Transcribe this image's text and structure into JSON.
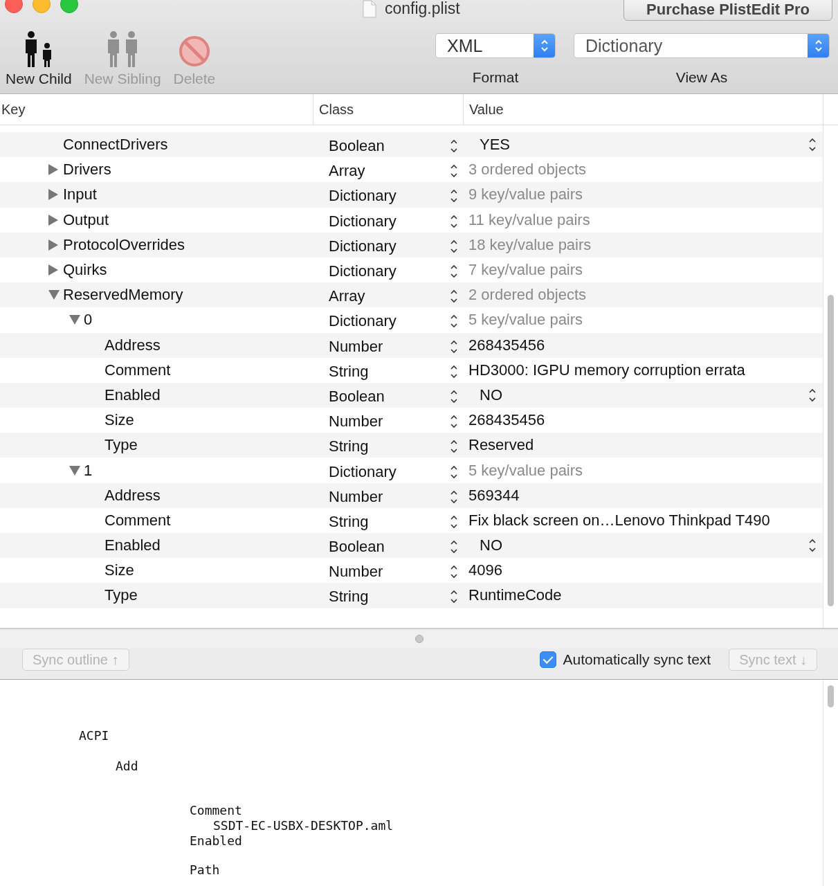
{
  "window": {
    "title": "config.plist",
    "purchase_button": "Purchase PlistEdit Pro"
  },
  "toolbar": {
    "items": [
      {
        "kind": "child",
        "label": "New Child",
        "disabled": false
      },
      {
        "kind": "sibling",
        "label": "New Sibling",
        "disabled": true
      },
      {
        "kind": "delete",
        "label": "Delete",
        "disabled": true
      }
    ],
    "format": {
      "label": "Format",
      "value": "XML"
    },
    "view_as": {
      "label": "View As",
      "value": "Dictionary"
    }
  },
  "table": {
    "columns": [
      "Key",
      "Class",
      "Value"
    ],
    "rows": [
      {
        "key": "ConnectDrivers",
        "class": "Boolean",
        "value": "YES",
        "kind": "bool"
      },
      {
        "key": "Drivers",
        "class": "Array",
        "value": "3 ordered objects",
        "kind": "count",
        "expanded": false
      },
      {
        "key": "Input",
        "class": "Dictionary",
        "value": "9 key/value pairs",
        "kind": "count",
        "expanded": false
      },
      {
        "key": "Output",
        "class": "Dictionary",
        "value": "11 key/value pairs",
        "kind": "count",
        "expanded": false
      },
      {
        "key": "ProtocolOverrides",
        "class": "Dictionary",
        "value": "18 key/value pairs",
        "kind": "count",
        "expanded": false
      },
      {
        "key": "Quirks",
        "class": "Dictionary",
        "value": "7 key/value pairs",
        "kind": "count",
        "expanded": false
      },
      {
        "key": "ReservedMemory",
        "class": "Array",
        "value": "2 ordered objects",
        "kind": "count",
        "expanded": true,
        "children": [
          {
            "key": "0",
            "class": "Dictionary",
            "value": "5 key/value pairs",
            "kind": "count",
            "expanded": true,
            "children": [
              {
                "key": "Address",
                "class": "Number",
                "value": "268435456",
                "kind": "text"
              },
              {
                "key": "Comment",
                "class": "String",
                "value": "HD3000: IGPU memory corruption errata",
                "kind": "text"
              },
              {
                "key": "Enabled",
                "class": "Boolean",
                "value": "NO",
                "kind": "bool"
              },
              {
                "key": "Size",
                "class": "Number",
                "value": "268435456",
                "kind": "text"
              },
              {
                "key": "Type",
                "class": "String",
                "value": "Reserved",
                "kind": "text"
              }
            ]
          },
          {
            "key": "1",
            "class": "Dictionary",
            "value": "5 key/value pairs",
            "kind": "count",
            "expanded": true,
            "children": [
              {
                "key": "Address",
                "class": "Number",
                "value": "569344",
                "kind": "text"
              },
              {
                "key": "Comment",
                "class": "String",
                "value": "Fix black screen on…Lenovo Thinkpad T490",
                "kind": "text"
              },
              {
                "key": "Enabled",
                "class": "Boolean",
                "value": "NO",
                "kind": "bool"
              },
              {
                "key": "Size",
                "class": "Number",
                "value": "4096",
                "kind": "text"
              },
              {
                "key": "Type",
                "class": "String",
                "value": "RuntimeCode",
                "kind": "text"
              }
            ]
          }
        ]
      }
    ]
  },
  "sync_bar": {
    "sync_outline": {
      "label": "Sync outline ↑",
      "disabled": true
    },
    "auto_sync": {
      "label": "Automatically sync text",
      "checked": true
    },
    "sync_text": {
      "label": "Sync text ↓",
      "disabled": true
    }
  },
  "text_view": {
    "lines": [
      {
        "text": "ACPI",
        "children": [
          {
            "text": "Add",
            "children": [
              {
                "text": "Comment",
                "children": [
                  {
                    "text": "SSDT-EC-USBX-DESKTOP.aml"
                  }
                ]
              },
              {
                "text": "Enabled"
              },
              {
                "text": "Path"
              }
            ]
          }
        ]
      }
    ]
  }
}
